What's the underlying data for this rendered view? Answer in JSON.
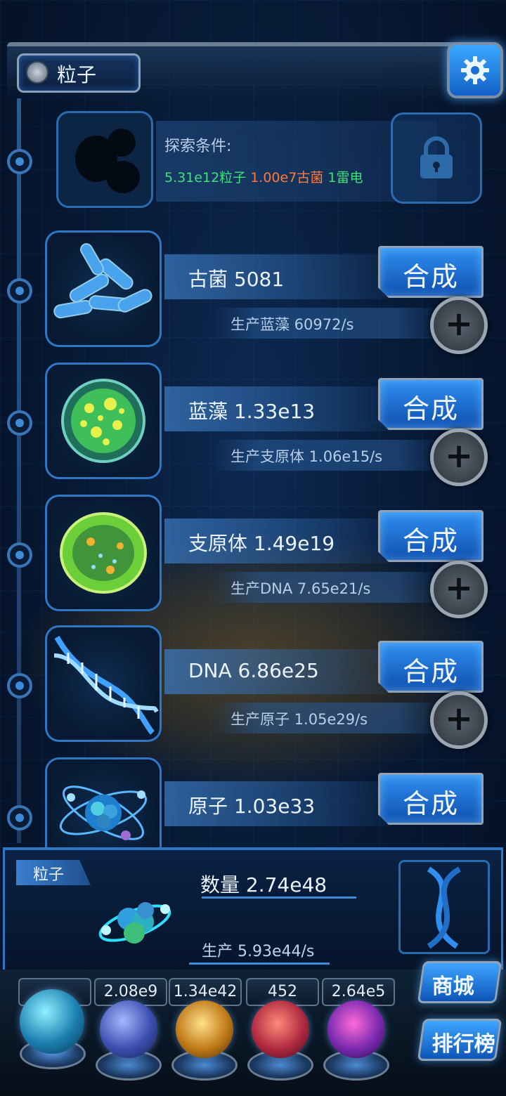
{
  "header": {
    "title": "粒子"
  },
  "explore": {
    "label": "探索条件:",
    "requirements": [
      {
        "text": "5.31e12粒子",
        "color": "#40e07a"
      },
      {
        "text": "1.00e7古菌",
        "color": "#ff7a3a"
      },
      {
        "text": "1雷电",
        "color": "#40e07a"
      }
    ]
  },
  "items": [
    {
      "name": "古菌 5081",
      "production": "生产蓝藻 60972/s",
      "button": "合成",
      "icon": "bacteria-icon"
    },
    {
      "name": "蓝藻 1.33e13",
      "production": "生产支原体 1.06e15/s",
      "button": "合成",
      "icon": "cyanobacteria-icon"
    },
    {
      "name": "支原体 1.49e19",
      "production": "生产DNA 7.65e21/s",
      "button": "合成",
      "icon": "mycoplasma-icon"
    },
    {
      "name": "DNA 6.86e25",
      "production": "生产原子 1.05e29/s",
      "button": "合成",
      "icon": "dna-icon"
    },
    {
      "name": "原子 1.03e33",
      "production": "",
      "button": "合成",
      "icon": "atom-icon"
    }
  ],
  "panel": {
    "tag": "粒子",
    "quantity": "数量 2.74e48",
    "production": "生产 5.93e44/s"
  },
  "resources": [
    {
      "value": "",
      "icon": "particle-orb-icon"
    },
    {
      "value": "2.08e9",
      "icon": "lightning-orb-icon"
    },
    {
      "value": "1.34e42",
      "icon": "galaxy-orb-icon"
    },
    {
      "value": "452",
      "icon": "brain-orb-icon"
    },
    {
      "value": "2.64e5",
      "icon": "vortex-orb-icon"
    }
  ],
  "side_buttons": {
    "shop": "商城",
    "ranking": "排行榜"
  },
  "colors": {
    "accent": "#2f8ff0",
    "requirement_green": "#40e07a",
    "requirement_orange": "#ff7a3a"
  }
}
